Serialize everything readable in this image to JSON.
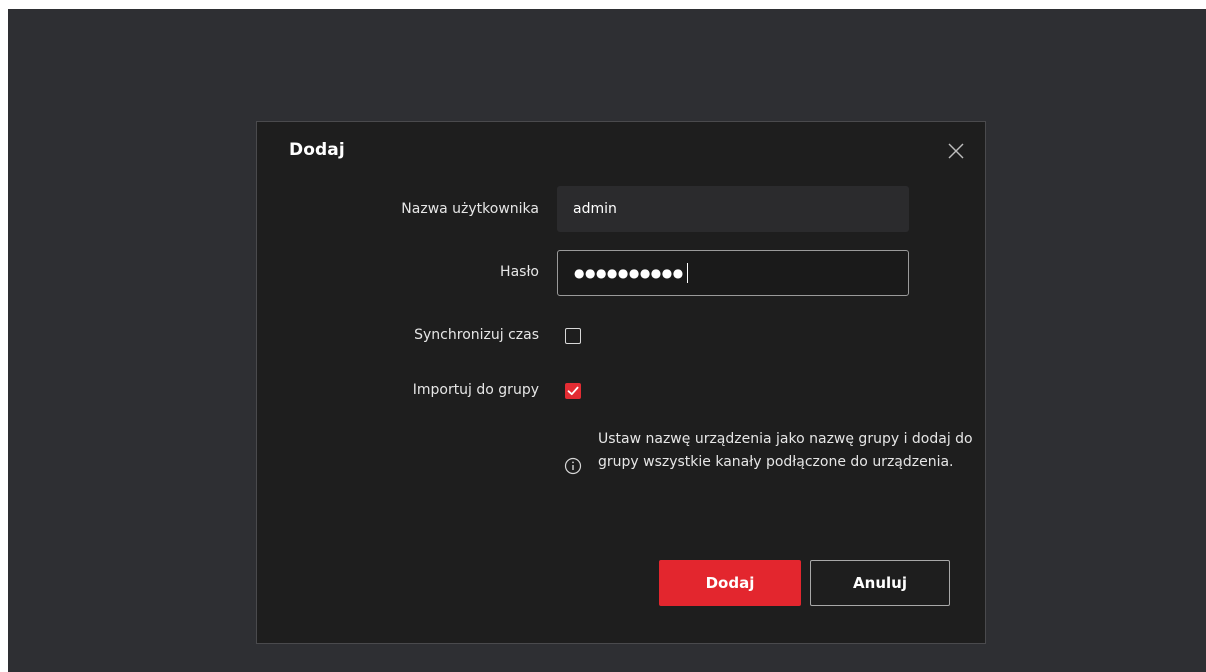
{
  "dialog": {
    "title": "Dodaj",
    "close_icon": "close-icon"
  },
  "form": {
    "username_label": "Nazwa użytkownika",
    "username_value": "admin",
    "password_label": "Hasło",
    "password_masked": "●●●●●●●●●●",
    "sync_time_label": "Synchronizuj czas",
    "sync_time_checked": false,
    "import_group_label": "Importuj do grupy",
    "import_group_checked": true,
    "info_text": "Ustaw nazwę urządzenia jako nazwę grupy i dodaj do grupy wszystkie kanały podłączone do urządzenia.",
    "info_icon": "info-icon"
  },
  "buttons": {
    "add_label": "Dodaj",
    "cancel_label": "Anuluj"
  },
  "colors": {
    "accent": "#e3262e",
    "dialog_bg": "#1e1e1e",
    "backdrop": "#2e2f33"
  }
}
